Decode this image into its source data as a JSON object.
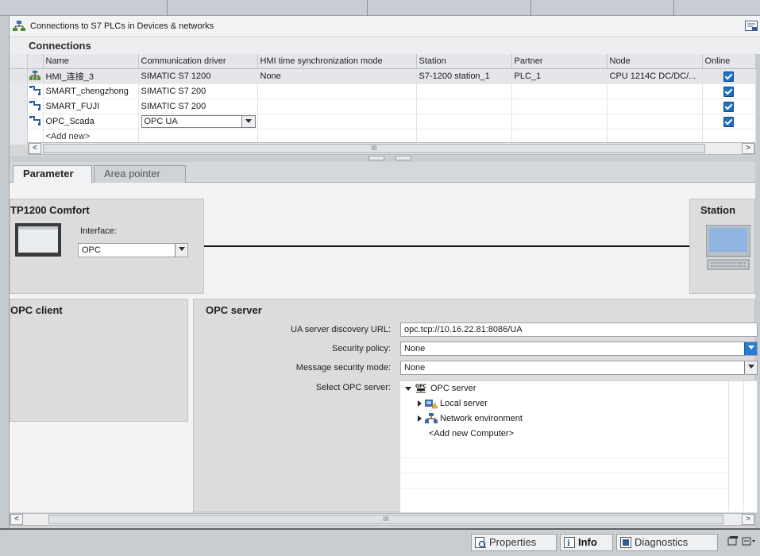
{
  "title": "Connections to S7 PLCs in Devices & networks",
  "connections": {
    "heading": "Connections",
    "columns": [
      "Name",
      "Communication driver",
      "HMI time synchronization mode",
      "Station",
      "Partner",
      "Node",
      "Online"
    ],
    "rows": [
      {
        "name": "HMI_连接_3",
        "driver": "SIMATIC S7 1200",
        "sync": "None",
        "station": "S7-1200 station_1",
        "partner": "PLC_1",
        "node": "CPU 1214C DC/DC/...",
        "online": true
      },
      {
        "name": "SMART_chengzhong",
        "driver": "SIMATIC S7 200",
        "sync": "",
        "station": "",
        "partner": "",
        "node": "",
        "online": true
      },
      {
        "name": "SMART_FUJI",
        "driver": "SIMATIC S7 200",
        "sync": "",
        "station": "",
        "partner": "",
        "node": "",
        "online": true
      },
      {
        "name": "OPC_Scada",
        "driver": "OPC UA",
        "sync": "",
        "station": "",
        "partner": "",
        "node": "",
        "online": true
      }
    ],
    "add_new": "<Add new>"
  },
  "tabs": {
    "parameter": "Parameter",
    "area_pointer": "Area pointer"
  },
  "device": {
    "name": "TP1200 Comfort",
    "interface_label": "Interface:",
    "interface_value": "OPC",
    "station_label": "Station"
  },
  "opc_client": {
    "title": "OPC client"
  },
  "opc_server": {
    "title": "OPC server",
    "url_label": "UA server discovery URL:",
    "url_value": "opc.tcp://10.16.22.81:8086/UA",
    "policy_label": "Security policy:",
    "policy_value": "None",
    "msgmode_label": "Message security mode:",
    "msgmode_value": "None",
    "select_label": "Select OPC server:",
    "tree": {
      "root": "OPC server",
      "local": "Local server",
      "network": "Network environment",
      "add": "<Add new Computer>"
    }
  },
  "bottom_tabs": {
    "properties": "Properties",
    "info": "Info",
    "diagnostics": "Diagnostics"
  },
  "scroll_glyph": "III",
  "colors": {
    "accent": "#1f6fc5",
    "selected_row": "#e4e6ea"
  }
}
